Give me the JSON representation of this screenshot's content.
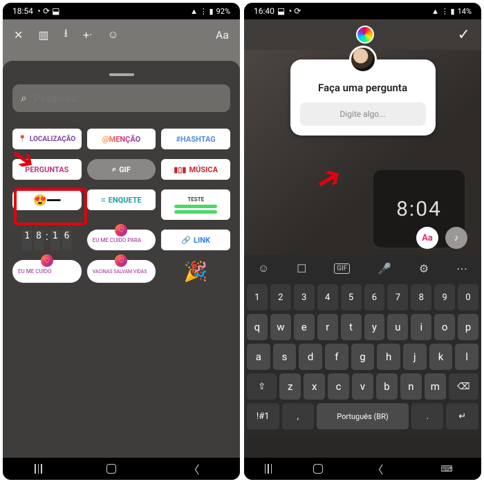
{
  "left": {
    "status": {
      "time": "18:54",
      "battery": "92%"
    },
    "toolbar_icons": [
      "close",
      "gallery",
      "download",
      "add",
      "effects",
      "text"
    ],
    "text_icon_label": "Aa",
    "search": {
      "placeholder": "Pesquisar"
    },
    "stickers": {
      "localizacao": "LOCALIZAÇÃO",
      "mencao": "@MENÇÃO",
      "hashtag": "#HASHTAG",
      "perguntas": "PERGUNTAS",
      "gif": "GIF",
      "musica": "MÚSICA",
      "enquete": "ENQUETE",
      "teste_label": "TESTE",
      "clock_digits": [
        "1",
        "8",
        "1",
        "6"
      ],
      "eu_me_cuido_para": "EU ME CUIDO PARA",
      "link": "LINK",
      "eu_me_cuido": "EU ME CUIDO",
      "vacinas": "VACINAS SALVAM VIDAS"
    }
  },
  "right": {
    "status": {
      "time": "16:40",
      "battery": "14%"
    },
    "watch_time": "8:04",
    "question": {
      "title": "Faça uma pergunta",
      "placeholder": "Digite algo..."
    },
    "chip_aa": "Aa",
    "keyboard": {
      "numbers": [
        "1",
        "2",
        "3",
        "4",
        "5",
        "6",
        "7",
        "8",
        "9",
        "0"
      ],
      "row1": [
        "q",
        "w",
        "e",
        "r",
        "t",
        "y",
        "u",
        "i",
        "o",
        "p"
      ],
      "row2": [
        "a",
        "s",
        "d",
        "f",
        "g",
        "h",
        "j",
        "k",
        "l"
      ],
      "row3": [
        "z",
        "x",
        "c",
        "v",
        "b",
        "n",
        "m"
      ],
      "shift": "⇧",
      "back": "⌫",
      "sym": "!#1",
      "comma": ",",
      "space": "Português (BR)",
      "dot": ".",
      "enter": "↵"
    }
  }
}
